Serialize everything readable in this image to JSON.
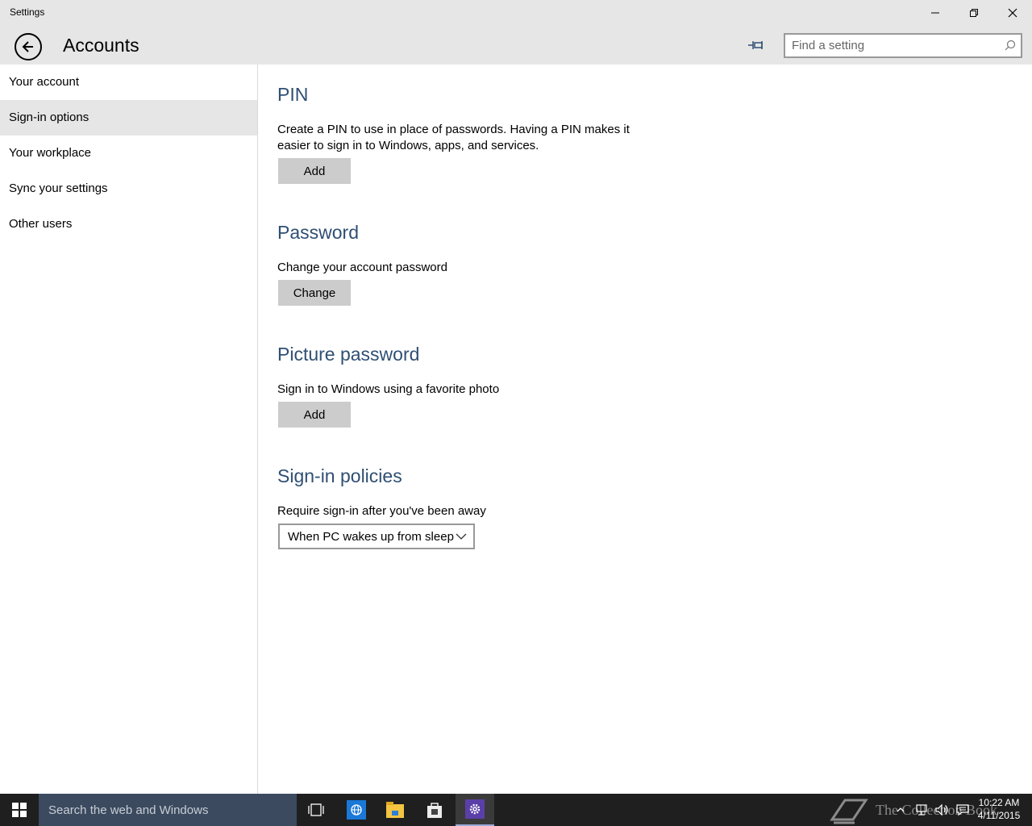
{
  "window": {
    "title": "Settings"
  },
  "header": {
    "title": "Accounts",
    "search_placeholder": "Find a setting"
  },
  "sidebar": {
    "items": [
      {
        "label": "Your account"
      },
      {
        "label": "Sign-in options",
        "active": true
      },
      {
        "label": "Your workplace"
      },
      {
        "label": "Sync your settings"
      },
      {
        "label": "Other users"
      }
    ]
  },
  "sections": {
    "pin": {
      "title": "PIN",
      "description": "Create a PIN to use in place of passwords. Having a PIN makes it easier to sign in to Windows, apps, and services.",
      "button": "Add"
    },
    "password": {
      "title": "Password",
      "description": "Change your account password",
      "button": "Change"
    },
    "picture_password": {
      "title": "Picture password",
      "description": "Sign in to Windows using a favorite photo",
      "button": "Add"
    },
    "signin_policies": {
      "title": "Sign-in policies",
      "description": "Require sign-in after you've been away",
      "selected": "When PC wakes up from sleep"
    }
  },
  "taskbar": {
    "search_placeholder": "Search the web and Windows",
    "watermark": "The Collection Book",
    "time": "10:22 AM",
    "date": "4/11/2015"
  },
  "colors": {
    "section_title": "#2f4f73",
    "chrome_bg": "#e6e6e6",
    "button_bg": "#cccccc",
    "taskbar_bg": "#1f1f1f",
    "taskbar_search_bg": "#3b4a5f"
  }
}
